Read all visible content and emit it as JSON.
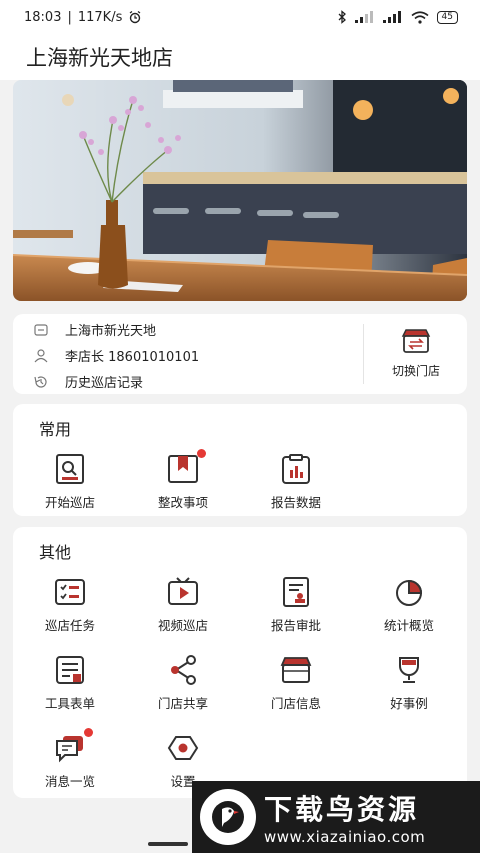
{
  "status_bar": {
    "time": "18:03",
    "speed": "117K/s",
    "battery": "45"
  },
  "header": {
    "title": "上海新光天地店"
  },
  "store_info": {
    "address": "上海市新光天地",
    "manager": "李店长 18601010101",
    "history": "历史巡店记录",
    "switch_label": "切换门店"
  },
  "common": {
    "title": "常用",
    "items": [
      {
        "label": "开始巡店",
        "icon": "search-doc-icon"
      },
      {
        "label": "整改事项",
        "icon": "bookmark-icon",
        "badge": true
      },
      {
        "label": "报告数据",
        "icon": "bar-chart-icon"
      }
    ]
  },
  "other": {
    "title": "其他",
    "items": [
      {
        "label": "巡店任务",
        "icon": "checklist-icon"
      },
      {
        "label": "视频巡店",
        "icon": "tv-play-icon"
      },
      {
        "label": "报告审批",
        "icon": "doc-stamp-icon"
      },
      {
        "label": "统计概览",
        "icon": "pie-chart-icon"
      },
      {
        "label": "工具表单",
        "icon": "form-icon"
      },
      {
        "label": "门店共享",
        "icon": "share-icon"
      },
      {
        "label": "门店信息",
        "icon": "store-icon"
      },
      {
        "label": "好事例",
        "icon": "trophy-icon"
      },
      {
        "label": "消息一览",
        "icon": "message-icon",
        "badge": true
      },
      {
        "label": "设置",
        "icon": "settings-icon"
      }
    ]
  },
  "watermark": {
    "title": "下载鸟资源",
    "url": "www.xiazainiao.com"
  },
  "colors": {
    "accent": "#b9342e",
    "badge": "#e53935",
    "background": "#f2f2f2"
  }
}
